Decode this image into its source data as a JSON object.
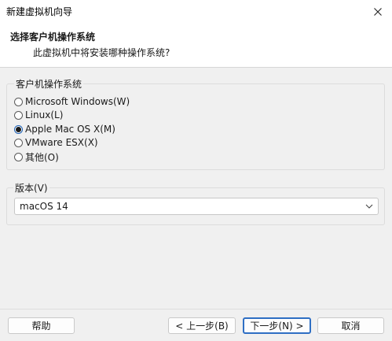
{
  "window": {
    "title": "新建虚拟机向导",
    "close_icon": "close-icon"
  },
  "header": {
    "heading": "选择客户机操作系统",
    "subheading": "此虚拟机中将安装哪种操作系统?"
  },
  "os_group": {
    "label": "客户机操作系统",
    "options": [
      {
        "label": "Microsoft Windows(W)",
        "checked": false
      },
      {
        "label": "Linux(L)",
        "checked": false
      },
      {
        "label": "Apple Mac OS X(M)",
        "checked": true
      },
      {
        "label": "VMware ESX(X)",
        "checked": false
      },
      {
        "label": "其他(O)",
        "checked": false
      }
    ]
  },
  "version_group": {
    "label": "版本(V)",
    "selected": "macOS 14",
    "chevron_icon": "chevron-down-icon"
  },
  "buttons": {
    "help": "帮助",
    "back": "< 上一步(B)",
    "next": "下一步(N) >",
    "cancel": "取消"
  }
}
